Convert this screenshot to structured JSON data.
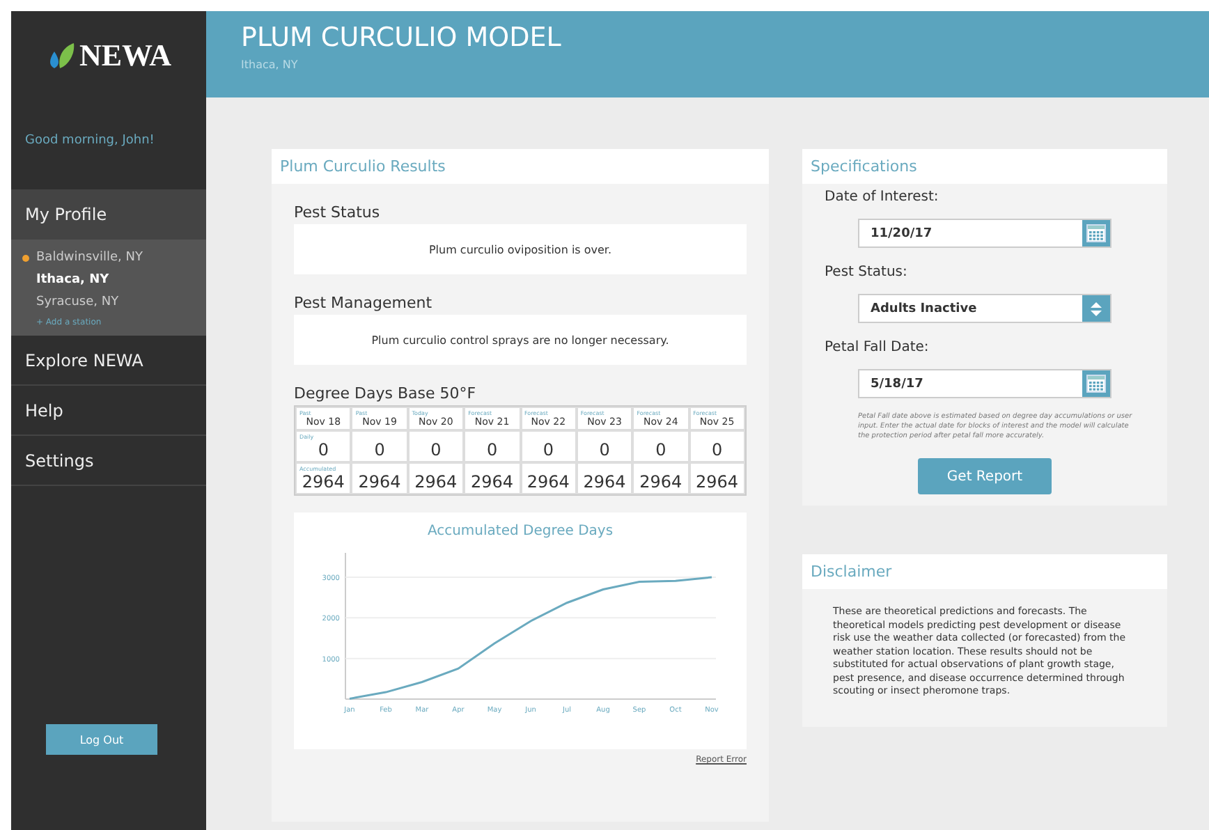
{
  "sidebar": {
    "logo": "NEWA",
    "greeting": "Good morning, John!",
    "profile": "My Profile",
    "stations": [
      {
        "name": "Baldwinsville, NY",
        "favorite": true,
        "selected": false
      },
      {
        "name": "Ithaca, NY",
        "favorite": false,
        "selected": true
      },
      {
        "name": "Syracuse, NY",
        "favorite": false,
        "selected": false
      }
    ],
    "add_station": "+ Add a station",
    "nav": [
      "Explore NEWA",
      "Help",
      "Settings"
    ],
    "logout": "Log Out"
  },
  "header": {
    "title": "PLUM CURCULIO MODEL",
    "location": "Ithaca, NY"
  },
  "results": {
    "title": "Plum Curculio Results",
    "pest_status": {
      "label": "Pest Status",
      "text": "Plum curculio oviposition is over."
    },
    "pest_management": {
      "label": "Pest Management",
      "text": "Plum curculio control sprays are no longer necessary."
    },
    "degree_days": {
      "title": "Degree Days Base 50°F",
      "daily_label": "Daily",
      "accumulated_label": "Accumulated",
      "columns": [
        {
          "kind": "Past",
          "date": "Nov 18",
          "daily": "0",
          "accumulated": "2964"
        },
        {
          "kind": "Past",
          "date": "Nov 19",
          "daily": "0",
          "accumulated": "2964"
        },
        {
          "kind": "Today",
          "date": "Nov 20",
          "daily": "0",
          "accumulated": "2964"
        },
        {
          "kind": "Forecast",
          "date": "Nov 21",
          "daily": "0",
          "accumulated": "2964"
        },
        {
          "kind": "Forecast",
          "date": "Nov 22",
          "daily": "0",
          "accumulated": "2964"
        },
        {
          "kind": "Forecast",
          "date": "Nov 23",
          "daily": "0",
          "accumulated": "2964"
        },
        {
          "kind": "Forecast",
          "date": "Nov 24",
          "daily": "0",
          "accumulated": "2964"
        },
        {
          "kind": "Forecast",
          "date": "Nov 25",
          "daily": "0",
          "accumulated": "2964"
        }
      ]
    },
    "chart_data": {
      "type": "line",
      "title": "Accumulated Degree Days",
      "categories": [
        "Jan",
        "Feb",
        "Mar",
        "Apr",
        "May",
        "Jun",
        "Jul",
        "Aug",
        "Sep",
        "Oct",
        "Nov"
      ],
      "grid": true,
      "series": [
        {
          "color": "#6aaabf",
          "values": [
            10,
            170,
            420,
            750,
            1370,
            1920,
            2370,
            2700,
            2890,
            2910,
            3000
          ]
        }
      ],
      "ylim": [
        0,
        3600
      ],
      "yticks": [
        1000,
        2000,
        3000
      ]
    },
    "report_error": "Report Error"
  },
  "specifications": {
    "title": "Specifications",
    "date_label": "Date of Interest:",
    "date_value": "11/20/17",
    "status_label": "Pest Status:",
    "status_value": "Adults Inactive",
    "petal_label": "Petal Fall Date:",
    "petal_value": "5/18/17",
    "note": "Petal Fall date above is estimated based on degree day accumulations or user input. Enter the actual date for blocks of interest and the model will calculate the protection period after petal fall more accurately.",
    "button": "Get Report"
  },
  "disclaimer": {
    "title": "Disclaimer",
    "text": "These are theoretical predictions and forecasts. The theoretical models predicting pest development or disease risk use the weather data collected (or forecasted) from the weather station location. These results should not be substituted for actual observations of plant growth stage, pest presence, and disease occurrence determined through scouting or insect pheromone traps."
  }
}
